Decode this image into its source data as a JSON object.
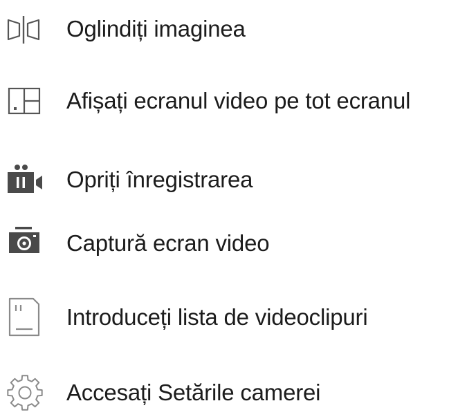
{
  "colors": {
    "icon_outline": "#555555",
    "icon_light": "#8a8a8a",
    "icon_fill": "#4a4a4a",
    "text": "#1c1c1c"
  },
  "menu": {
    "items": [
      {
        "label": "Oglindiți imaginea",
        "icon": "mirror-image-icon"
      },
      {
        "label": "Afișați ecranul video pe tot ecranul",
        "icon": "fullscreen-icon"
      },
      {
        "label": "Opriți înregistrarea",
        "icon": "stop-recording-icon"
      },
      {
        "label": "Captură ecran video",
        "icon": "camera-snapshot-icon"
      },
      {
        "label": "Introduceți lista de videoclipuri",
        "icon": "sd-card-icon"
      },
      {
        "label": "Accesați Setările camerei",
        "icon": "gear-icon"
      }
    ]
  }
}
